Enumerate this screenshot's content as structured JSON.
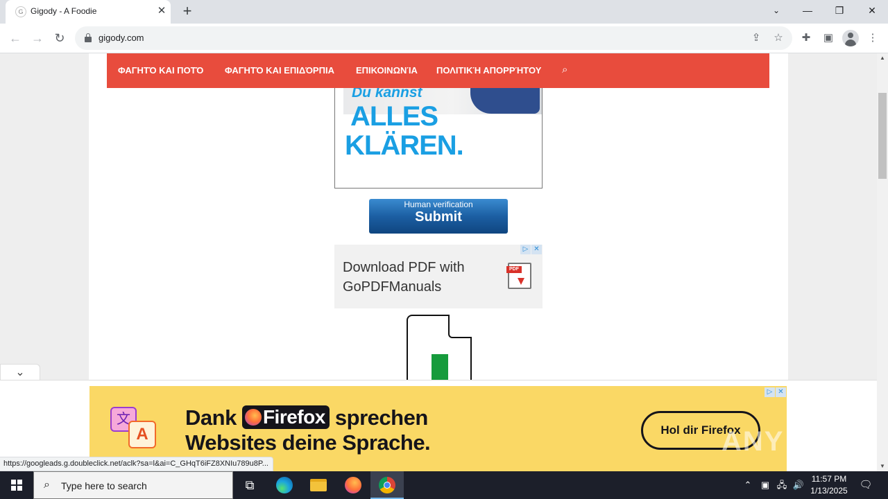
{
  "browser": {
    "tab_title": "Gigody - A Foodie",
    "tab_favicon": "G",
    "url": "gigody.com",
    "status_url": "https://googleads.g.doubleclick.net/aclk?sa=l&ai=C_GHqT6iFZ8XNIu789u8P...",
    "icons": [
      "back-icon",
      "forward-icon",
      "reload-icon",
      "lock-icon",
      "share-icon",
      "star-icon",
      "extensions-icon",
      "side-panel-icon",
      "profile-icon",
      "menu-icon"
    ]
  },
  "site": {
    "nav": [
      "ΦΑΓΗΤΌ ΚΑΙ ΠΟΤΌ",
      "ΦΑΓΗΤΌ ΚΑΙ ΕΠΙΔΌΡΠΙΑ",
      "ΕΠΙΚΟΙΝΩΝΊΑ",
      "ΠΟΛΙΤΙΚΉ ΑΠΟΡΡΉΤΟΥ"
    ],
    "nav_color": "#e84c3d"
  },
  "ad_top": {
    "line1": "Du kannst",
    "line2": "ALLES",
    "line3": "KLÄREN."
  },
  "verify_button": {
    "small": "Human verification",
    "big": "Submit"
  },
  "ad_pdf": {
    "text": "Download PDF with GoPDFManuals",
    "pdf_label": "PDF"
  },
  "ad_bottom": {
    "line1_before": "Dank",
    "brand": "Firefox",
    "line1_after": "sprechen",
    "line2": "Websites deine Sprache.",
    "cta": "Hol dir Firefox",
    "translate_a": "文",
    "translate_b": "A",
    "bg_color": "#fad865"
  },
  "watermark": "ANY RUN",
  "taskbar": {
    "search_placeholder": "Type here to search",
    "time": "11:57 PM",
    "date": "1/13/2025"
  }
}
